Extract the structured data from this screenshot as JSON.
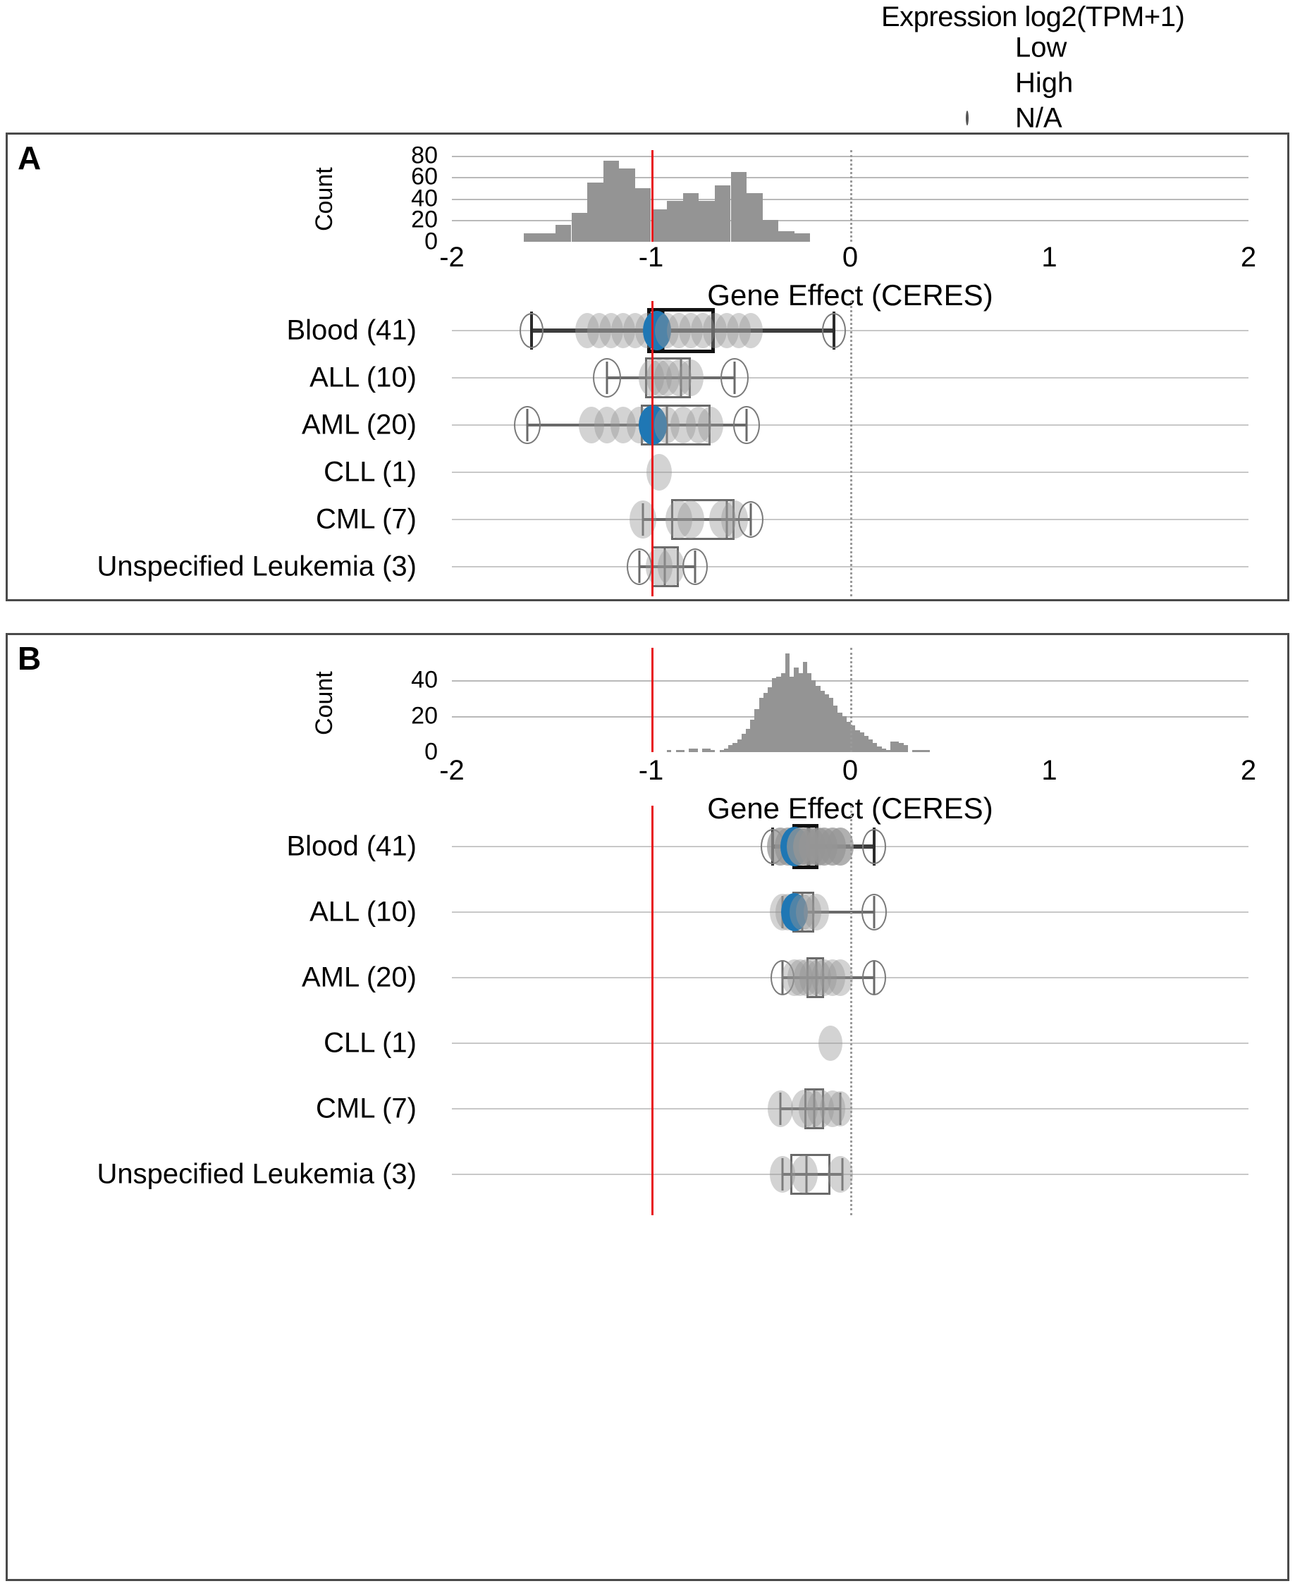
{
  "legend": {
    "title": "Expression log2(TPM+1)",
    "items": [
      {
        "label": "Low",
        "key": "small-grey-dot"
      },
      {
        "label": "High",
        "key": "large-grey-dot"
      },
      {
        "label": "N/A",
        "key": "open-circle"
      }
    ]
  },
  "colors": {
    "threshold_line": "#e8141b",
    "zero_line": "#9a9a9a",
    "bar_fill": "#949494",
    "highlight_point": "#1f77b4",
    "point_grey": "#969696"
  },
  "panels": [
    {
      "letter": "A",
      "histogram": {
        "ylabel": "Count",
        "yticks": [
          0,
          20,
          40,
          60,
          80
        ],
        "ylim": [
          0,
          85
        ],
        "xlabel": "Gene Effect (CERES)",
        "xticks": [
          -2,
          -1,
          0,
          1,
          2
        ],
        "xlim": [
          -2,
          2
        ],
        "threshold_x": -1,
        "zero_x": 0,
        "bin_width": 0.08,
        "bins_start": -1.64,
        "counts": [
          8,
          8,
          16,
          27,
          55,
          75,
          68,
          50,
          30,
          38,
          45,
          38,
          52,
          65,
          45,
          20,
          10,
          8
        ]
      },
      "rows": [
        {
          "label": "Blood (41)",
          "emphasis": true,
          "box": {
            "q1": -1.02,
            "median": -0.94,
            "q3": -0.68,
            "low": -1.6,
            "high": -0.08
          },
          "points": [
            {
              "x": -1.6,
              "size": 34,
              "style": "na"
            },
            {
              "x": -1.32,
              "size": 34,
              "style": "grey"
            },
            {
              "x": -1.26,
              "size": 34,
              "style": "grey"
            },
            {
              "x": -1.2,
              "size": 34,
              "style": "grey"
            },
            {
              "x": -1.14,
              "size": 34,
              "style": "grey"
            },
            {
              "x": -1.08,
              "size": 34,
              "style": "grey"
            },
            {
              "x": -1.02,
              "size": 34,
              "style": "grey"
            },
            {
              "x": -0.97,
              "size": 40,
              "style": "blue"
            },
            {
              "x": -0.92,
              "size": 34,
              "style": "grey"
            },
            {
              "x": -0.86,
              "size": 34,
              "style": "grey"
            },
            {
              "x": -0.8,
              "size": 34,
              "style": "grey"
            },
            {
              "x": -0.74,
              "size": 34,
              "style": "grey"
            },
            {
              "x": -0.68,
              "size": 34,
              "style": "grey"
            },
            {
              "x": -0.62,
              "size": 34,
              "style": "grey"
            },
            {
              "x": -0.56,
              "size": 34,
              "style": "grey"
            },
            {
              "x": -0.5,
              "size": 34,
              "style": "grey"
            },
            {
              "x": -0.08,
              "size": 34,
              "style": "na"
            }
          ]
        },
        {
          "label": "ALL (10)",
          "emphasis": false,
          "box": {
            "q1": -1.03,
            "median": -0.85,
            "q3": -0.8,
            "low": -1.22,
            "high": -0.58
          },
          "points": [
            {
              "x": -1.22,
              "size": 40,
              "style": "na"
            },
            {
              "x": -1.0,
              "size": 36,
              "style": "grey"
            },
            {
              "x": -0.96,
              "size": 36,
              "style": "grey"
            },
            {
              "x": -0.92,
              "size": 36,
              "style": "grey"
            },
            {
              "x": -0.86,
              "size": 36,
              "style": "grey"
            },
            {
              "x": -0.8,
              "size": 36,
              "style": "grey"
            },
            {
              "x": -0.58,
              "size": 40,
              "style": "na"
            }
          ]
        },
        {
          "label": "AML (20)",
          "emphasis": false,
          "box": {
            "q1": -1.05,
            "median": -0.92,
            "q3": -0.7,
            "low": -1.62,
            "high": -0.52
          },
          "points": [
            {
              "x": -1.62,
              "size": 38,
              "style": "na"
            },
            {
              "x": -1.3,
              "size": 36,
              "style": "grey"
            },
            {
              "x": -1.22,
              "size": 36,
              "style": "grey"
            },
            {
              "x": -1.14,
              "size": 36,
              "style": "grey"
            },
            {
              "x": -1.06,
              "size": 36,
              "style": "grey"
            },
            {
              "x": -0.99,
              "size": 40,
              "style": "blue"
            },
            {
              "x": -0.92,
              "size": 36,
              "style": "grey"
            },
            {
              "x": -0.84,
              "size": 36,
              "style": "grey"
            },
            {
              "x": -0.76,
              "size": 36,
              "style": "grey"
            },
            {
              "x": -0.7,
              "size": 36,
              "style": "grey"
            },
            {
              "x": -0.52,
              "size": 38,
              "style": "na"
            }
          ]
        },
        {
          "label": "CLL (1)",
          "emphasis": false,
          "box": null,
          "points": [
            {
              "x": -0.96,
              "size": 36,
              "style": "grey"
            }
          ]
        },
        {
          "label": "CML (7)",
          "emphasis": false,
          "box": {
            "q1": -0.9,
            "median": -0.62,
            "q3": -0.58,
            "low": -1.04,
            "high": -0.5
          },
          "points": [
            {
              "x": -1.04,
              "size": 38,
              "style": "grey"
            },
            {
              "x": -0.86,
              "size": 38,
              "style": "grey"
            },
            {
              "x": -0.8,
              "size": 38,
              "style": "grey"
            },
            {
              "x": -0.64,
              "size": 38,
              "style": "grey"
            },
            {
              "x": -0.58,
              "size": 38,
              "style": "grey"
            },
            {
              "x": -0.5,
              "size": 36,
              "style": "na"
            }
          ]
        },
        {
          "label": "Unspecified Leukemia (3)",
          "emphasis": false,
          "box": {
            "q1": -1.0,
            "median": -0.93,
            "q3": -0.86,
            "low": -1.06,
            "high": -0.78
          },
          "points": [
            {
              "x": -1.06,
              "size": 36,
              "style": "na"
            },
            {
              "x": -0.96,
              "size": 38,
              "style": "grey"
            },
            {
              "x": -0.9,
              "size": 38,
              "style": "grey"
            },
            {
              "x": -0.78,
              "size": 36,
              "style": "na"
            }
          ]
        }
      ]
    },
    {
      "letter": "B",
      "histogram": {
        "ylabel": "Count",
        "yticks": [
          0,
          20,
          40
        ],
        "ylim": [
          0,
          58
        ],
        "xlabel": "Gene Effect (CERES)",
        "xticks": [
          -2,
          -1,
          0,
          1,
          2
        ],
        "xlim": [
          -2,
          2
        ],
        "threshold_x": -1,
        "zero_x": 0,
        "bin_width": 0.022,
        "bins_start": -0.92,
        "counts": [
          1,
          0,
          1,
          1,
          0,
          2,
          2,
          0,
          2,
          2,
          1,
          0,
          1,
          2,
          4,
          5,
          7,
          10,
          13,
          18,
          24,
          30,
          33,
          36,
          41,
          42,
          44,
          55,
          42,
          47,
          44,
          50,
          44,
          40,
          37,
          34,
          32,
          30,
          26,
          22,
          20,
          17,
          15,
          12,
          11,
          9,
          7,
          5,
          3,
          2,
          1,
          6,
          6,
          5,
          4,
          0,
          1,
          1,
          1,
          1
        ]
      },
      "rows": [
        {
          "label": "Blood (41)",
          "emphasis": true,
          "box": {
            "q1": -0.29,
            "median": -0.21,
            "q3": -0.16,
            "low": -0.39,
            "high": 0.12
          },
          "points": [
            {
              "x": -0.39,
              "size": 34,
              "style": "na"
            },
            {
              "x": -0.35,
              "size": 38,
              "style": "grey-s"
            },
            {
              "x": -0.31,
              "size": 38,
              "style": "grey-s"
            },
            {
              "x": -0.28,
              "size": 40,
              "style": "blue"
            },
            {
              "x": -0.25,
              "size": 38,
              "style": "grey-s"
            },
            {
              "x": -0.22,
              "size": 38,
              "style": "grey-s"
            },
            {
              "x": -0.19,
              "size": 38,
              "style": "grey-s"
            },
            {
              "x": -0.16,
              "size": 38,
              "style": "grey-s"
            },
            {
              "x": -0.13,
              "size": 38,
              "style": "grey-s"
            },
            {
              "x": -0.09,
              "size": 38,
              "style": "grey-s"
            },
            {
              "x": -0.05,
              "size": 38,
              "style": "grey-s"
            },
            {
              "x": 0.12,
              "size": 34,
              "style": "na"
            }
          ]
        },
        {
          "label": "ALL (10)",
          "emphasis": false,
          "box": {
            "q1": -0.29,
            "median": -0.24,
            "q3": -0.18,
            "low": -0.34,
            "high": 0.12
          },
          "points": [
            {
              "x": -0.34,
              "size": 36,
              "style": "grey"
            },
            {
              "x": -0.31,
              "size": 36,
              "style": "grey"
            },
            {
              "x": -0.28,
              "size": 38,
              "style": "blue"
            },
            {
              "x": -0.24,
              "size": 36,
              "style": "grey"
            },
            {
              "x": -0.21,
              "size": 36,
              "style": "grey"
            },
            {
              "x": -0.17,
              "size": 36,
              "style": "grey"
            },
            {
              "x": 0.12,
              "size": 36,
              "style": "na"
            }
          ]
        },
        {
          "label": "AML (20)",
          "emphasis": false,
          "box": {
            "q1": -0.22,
            "median": -0.17,
            "q3": -0.13,
            "low": -0.34,
            "high": 0.12
          },
          "points": [
            {
              "x": -0.34,
              "size": 34,
              "style": "na"
            },
            {
              "x": -0.28,
              "size": 36,
              "style": "grey"
            },
            {
              "x": -0.25,
              "size": 36,
              "style": "grey"
            },
            {
              "x": -0.22,
              "size": 36,
              "style": "grey"
            },
            {
              "x": -0.19,
              "size": 36,
              "style": "grey"
            },
            {
              "x": -0.16,
              "size": 36,
              "style": "grey"
            },
            {
              "x": -0.13,
              "size": 36,
              "style": "grey"
            },
            {
              "x": -0.09,
              "size": 36,
              "style": "grey"
            },
            {
              "x": -0.05,
              "size": 36,
              "style": "grey"
            },
            {
              "x": 0.12,
              "size": 34,
              "style": "na"
            }
          ]
        },
        {
          "label": "CLL (1)",
          "emphasis": false,
          "box": null,
          "points": [
            {
              "x": -0.1,
              "size": 34,
              "style": "grey"
            }
          ]
        },
        {
          "label": "CML (7)",
          "emphasis": false,
          "box": {
            "q1": -0.23,
            "median": -0.18,
            "q3": -0.13,
            "low": -0.35,
            "high": -0.05
          },
          "points": [
            {
              "x": -0.35,
              "size": 36,
              "style": "grey"
            },
            {
              "x": -0.23,
              "size": 38,
              "style": "grey"
            },
            {
              "x": -0.19,
              "size": 38,
              "style": "grey"
            },
            {
              "x": -0.15,
              "size": 38,
              "style": "grey"
            },
            {
              "x": -0.09,
              "size": 36,
              "style": "grey"
            },
            {
              "x": -0.05,
              "size": 34,
              "style": "grey"
            }
          ]
        },
        {
          "label": "Unspecified Leukemia (3)",
          "emphasis": false,
          "box": {
            "q1": -0.3,
            "median": -0.22,
            "q3": -0.1,
            "low": -0.34,
            "high": -0.04
          },
          "points": [
            {
              "x": -0.34,
              "size": 36,
              "style": "grey"
            },
            {
              "x": -0.23,
              "size": 38,
              "style": "grey"
            },
            {
              "x": -0.05,
              "size": 36,
              "style": "grey"
            }
          ]
        }
      ]
    }
  ],
  "chart_data": {
    "type": "bar",
    "title": "Gene Effect (CERES) distributions with per-lineage dot/box plots",
    "xlabel": "Gene Effect (CERES)",
    "ylabel": "Count",
    "xlim": [
      -2,
      2
    ],
    "grid": true,
    "legend_position": "top-right",
    "annotations": [
      "red vertical line at Gene Effect = -1 (essentiality threshold)",
      "grey dotted vertical line at Gene Effect = 0 (no effect)"
    ],
    "subplots": [
      {
        "panel": "A",
        "type": "bar",
        "ylabel": "Count",
        "ylim": [
          0,
          85
        ],
        "yticks": [
          0,
          20,
          40,
          60,
          80
        ],
        "xticks": [
          -2,
          -1,
          0,
          1,
          2
        ],
        "bin_centers": [
          -1.6,
          -1.52,
          -1.44,
          -1.36,
          -1.28,
          -1.2,
          -1.12,
          -1.04,
          -0.96,
          -0.88,
          -0.8,
          -0.72,
          -0.64,
          -0.56,
          -0.48,
          -0.4,
          -0.32,
          -0.24
        ],
        "values": [
          8,
          8,
          16,
          27,
          55,
          75,
          68,
          50,
          30,
          38,
          45,
          38,
          52,
          65,
          45,
          20,
          10,
          8
        ],
        "categories_rows": [
          "Blood (41)",
          "ALL (10)",
          "AML (20)",
          "CLL (1)",
          "CML (7)",
          "Unspecified Leukemia (3)"
        ],
        "row_medians": [
          -0.94,
          -0.85,
          -0.92,
          -0.96,
          -0.62,
          -0.93
        ]
      },
      {
        "panel": "B",
        "type": "bar",
        "ylabel": "Count",
        "ylim": [
          0,
          58
        ],
        "yticks": [
          0,
          20,
          40
        ],
        "xticks": [
          -2,
          -1,
          0,
          1,
          2
        ],
        "peak_x": -0.28,
        "peak_count": 55,
        "categories_rows": [
          "Blood (41)",
          "ALL (10)",
          "AML (20)",
          "CLL (1)",
          "CML (7)",
          "Unspecified Leukemia (3)"
        ],
        "row_medians": [
          -0.21,
          -0.24,
          -0.17,
          -0.1,
          -0.18,
          -0.22
        ]
      }
    ]
  }
}
